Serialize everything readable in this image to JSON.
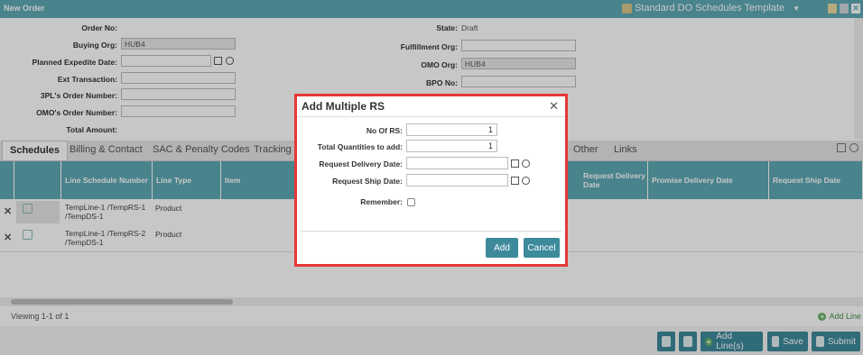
{
  "window": {
    "title": "New Order",
    "template_label": "Standard DO Schedules Template"
  },
  "form": {
    "order_no_label": "Order No:",
    "buying_org_label": "Buying Org:",
    "buying_org_value": "HUB4",
    "planned_expedite_label": "Planned Expedite Date:",
    "ext_transaction_label": "Ext Transaction:",
    "tpl_order_label": "3PL's Order Number:",
    "omo_order_label": "OMO's Order Number:",
    "total_amount_label": "Total Amount:",
    "state_label": "State:",
    "state_value": "Draft",
    "fulfillment_org_label": "Fulfillment Org:",
    "omo_org_label": "OMO Org:",
    "omo_org_value": "HUB4",
    "bpo_no_label": "BPO No:"
  },
  "tabs": [
    "Schedules",
    "Billing & Contact",
    "SAC & Penalty Codes",
    "Tracking",
    "Other",
    "Links"
  ],
  "grid": {
    "columns": {
      "line_schedule": "Line Schedule Number",
      "line_type": "Line Type",
      "item": "Item",
      "request_delivery": "Request Delivery Date",
      "promise_delivery": "Promise Delivery Date",
      "request_ship": "Request Ship Date"
    },
    "rows": [
      {
        "line_schedule": "TempLine-1 /TempRS-1 /TempDS-1",
        "line_type": "Product"
      },
      {
        "line_schedule": "TempLine-1 /TempRS-2 /TempDS-1",
        "line_type": "Product"
      }
    ],
    "viewing": "Viewing 1-1 of 1",
    "add_line_link": "Add Line"
  },
  "bottom": {
    "add_lines": "Add Line(s)",
    "save": "Save",
    "submit": "Submit"
  },
  "dialog": {
    "title": "Add Multiple RS",
    "close": "✕",
    "no_of_rs_label": "No Of RS:",
    "no_of_rs_value": "1",
    "total_qty_label": "Total Quantities to add:",
    "total_qty_value": "1",
    "req_delivery_label": "Request Delivery Date:",
    "req_ship_label": "Request Ship Date:",
    "remember_label": "Remember:",
    "add": "Add",
    "cancel": "Cancel"
  },
  "colors": {
    "header": "#5ea8b4",
    "button": "#3d8a9b",
    "highlight": "#e53935"
  }
}
